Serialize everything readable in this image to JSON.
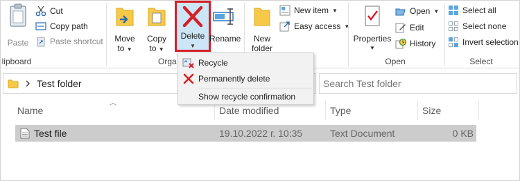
{
  "ribbon": {
    "clipboard": {
      "paste": "Paste",
      "cut": "Cut",
      "copy_path": "Copy path",
      "paste_shortcut": "Paste shortcut",
      "group_label": "lipboard"
    },
    "organize": {
      "move_to_1": "Move",
      "move_to_2": "to",
      "copy_to_1": "Copy",
      "copy_to_2": "to",
      "delete": "Delete",
      "rename": "Rename",
      "group_label": "Orga"
    },
    "new": {
      "new_folder_1": "New",
      "new_folder_2": "folder",
      "new_item": "New item",
      "easy_access": "Easy access"
    },
    "open": {
      "properties": "Properties",
      "open": "Open",
      "edit": "Edit",
      "history": "History",
      "group_label": "Open"
    },
    "select": {
      "select_all": "Select all",
      "select_none": "Select none",
      "invert_selection": "Invert selection",
      "group_label": "Select"
    }
  },
  "delete_menu": {
    "recycle": "Recycle",
    "permanently_delete": "Permanently delete",
    "show_recycle_confirmation": "Show recycle confirmation"
  },
  "address": {
    "path": "Test folder",
    "search_placeholder": "Search Test folder"
  },
  "columns": {
    "name": "Name",
    "date_modified": "Date modified",
    "type": "Type",
    "size": "Size"
  },
  "files": [
    {
      "name": "Test file",
      "date": "19.10.2022 г. 10:35",
      "type": "Text Document",
      "size": "0 KB"
    }
  ],
  "colors": {
    "highlight_red": "#d71f26",
    "delete_x_red": "#d71f26",
    "selection_blue": "#cde6f7",
    "folder_yellow": "#f7c948",
    "row_selected": "#cccccc"
  },
  "icons": [
    "clipboard-icon",
    "scissors-icon",
    "copy-path-icon",
    "paste-shortcut-icon",
    "move-to-icon",
    "copy-to-icon",
    "delete-x-icon",
    "rename-icon",
    "new-folder-icon",
    "new-item-icon",
    "easy-access-icon",
    "properties-icon",
    "open-icon",
    "edit-icon",
    "history-icon",
    "select-all-icon",
    "select-none-icon",
    "invert-selection-icon",
    "recycle-icon",
    "permanent-delete-icon",
    "folder-icon",
    "chevron-right-icon",
    "sort-arrow-icon",
    "text-file-icon"
  ]
}
